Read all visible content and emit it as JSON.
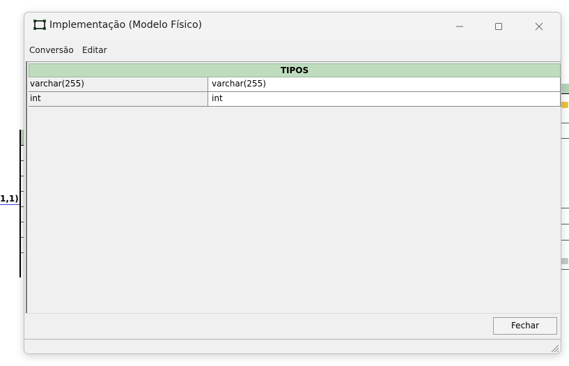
{
  "window": {
    "title": "Implementação (Modelo Físico)"
  },
  "menu": {
    "items": [
      "Conversão",
      "Editar"
    ]
  },
  "table": {
    "header": "TIPOS",
    "rows": [
      [
        "varchar(255)",
        "varchar(255)"
      ],
      [
        "int",
        "int"
      ]
    ]
  },
  "buttons": {
    "close_label": "Fechar"
  },
  "background": {
    "cardinality_label": "1,1)"
  },
  "colors": {
    "header_green": "#bfdcbf",
    "entity_green": "#b9d3b9",
    "relationship_line": "#3b3bd6"
  }
}
